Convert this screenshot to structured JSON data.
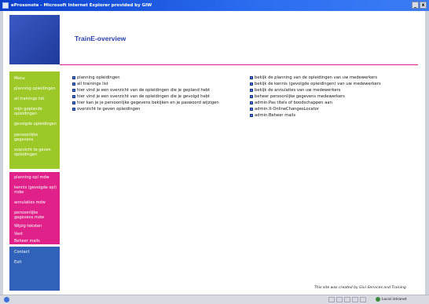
{
  "window": {
    "title": "eProsonote - Microsoft Internet Explorer provided by GIW",
    "min_label": "_",
    "close_label": "x"
  },
  "header": {
    "title": "TrainE-overview"
  },
  "sidebar": {
    "green": [
      "Menu",
      "planning opleidingen",
      "all trainings list",
      "mijn geplande opleidingen",
      "gevolgde opleidingen",
      "persoonlijke gegevens",
      "overzicht te geven opleidingen"
    ],
    "pink": [
      "planning opl mdw",
      "kennis (gevolgde opl) mdw",
      "annulaties mdw",
      "persoonlijke gegevens mdw",
      "Wijzig teksten",
      "Vast",
      "Beheer mails"
    ],
    "blue": [
      "Contact",
      "Exit"
    ]
  },
  "main": {
    "left_links": [
      "planning opleidingen",
      "all trainings list",
      "hier vind je een overzicht van de opleidingen die je gepland hebt",
      "hier vind je een overzicht van de opleidingen die je gevolgd hebt",
      "hier kan je je persoonlijke gegevens bekijken en je paswoord wijzigen",
      "overzicht te geven opleidingen"
    ],
    "right_links": [
      "bekijk de planning van de opleidingen van uw medewerkers",
      "bekijk de kennis (gevolgde opleidingen) van uw medewerkers",
      "bekijk de annulaties van uw medewerkers",
      "beheer persoonlijke gegevens medewerkers",
      "admin:Pas titels of boodschappen aan",
      "admin:X-OnlineChangesLocator",
      "admin:Beheer mails"
    ]
  },
  "footer": {
    "note": "This site was created by Givi Services and Training"
  },
  "statusbar": {
    "zone": "Local intranet"
  },
  "colors": {
    "green": "#9cc928",
    "pink": "#e0218a",
    "blue": "#2f62b8",
    "title_blue": "#2a40a8"
  }
}
